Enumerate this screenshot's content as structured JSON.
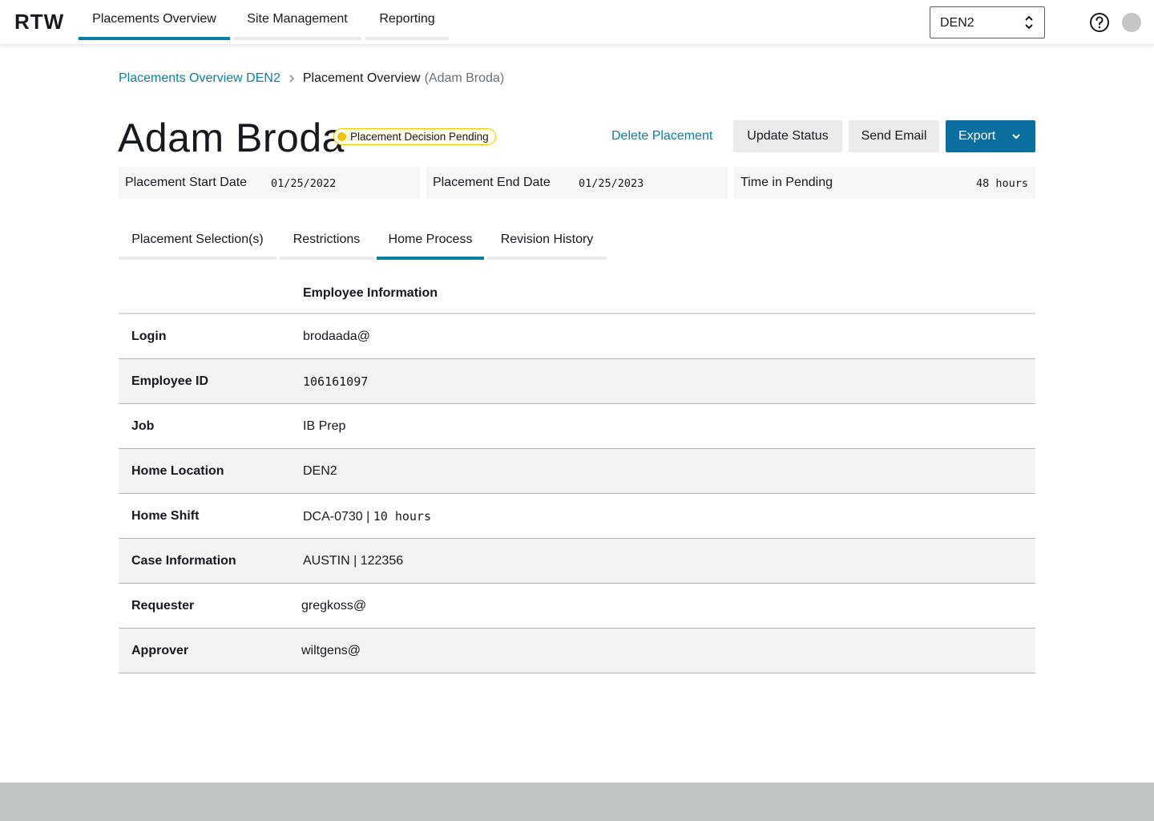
{
  "app": {
    "logo": "RTW"
  },
  "nav": {
    "tabs": [
      {
        "label": "Placements Overview",
        "active": true
      },
      {
        "label": "Site Management",
        "active": false
      },
      {
        "label": "Reporting",
        "active": false
      }
    ],
    "site_select": {
      "value": "DEN2"
    }
  },
  "icons": {
    "help": "help-circle-icon",
    "select": "sort-chevrons-icon",
    "breadcrumb_sep": "chevron-right-icon",
    "export": "chevron-down-icon"
  },
  "breadcrumb": {
    "parent": "Placements Overview DEN2",
    "current": "Placement Overview",
    "current_detail": "(Adam Broda)"
  },
  "header": {
    "name": "Adam Broda",
    "status": "Placement Decision Pending",
    "actions": {
      "delete": "Delete Placement",
      "update": "Update Status",
      "email": "Send Email",
      "export": "Export"
    }
  },
  "summary": {
    "start_label": "Placement Start Date",
    "start_value": "01/25/2022",
    "end_label": "Placement End Date",
    "end_value": "01/25/2023",
    "pending_label": "Time in Pending",
    "pending_value": "48 hours"
  },
  "tabs": [
    {
      "label": "Placement Selection(s)",
      "active": false
    },
    {
      "label": "Restrictions",
      "active": false
    },
    {
      "label": "Home Process",
      "active": true
    },
    {
      "label": "Revision History",
      "active": false
    }
  ],
  "table": {
    "title": "Employee Information",
    "rows": [
      {
        "key": "Login",
        "value": "brodaada@"
      },
      {
        "key": "Employee ID",
        "value": "106161097"
      },
      {
        "key": "Job",
        "value": "IB Prep"
      },
      {
        "key": "Home Location",
        "value": "DEN2"
      },
      {
        "key": "Home Shift",
        "value_prefix": "DCA-0730 | ",
        "value_mono": "10 hours"
      },
      {
        "key": "Case Information",
        "value": "AUSTIN | 122356"
      },
      {
        "key": "Requester",
        "value": "gregkoss@"
      },
      {
        "key": "Approver",
        "value": "wiltgens@"
      }
    ]
  },
  "colors": {
    "accent": "#0a7ea4",
    "primary_button": "#0a6e9e",
    "pending": "#f2c40d"
  }
}
